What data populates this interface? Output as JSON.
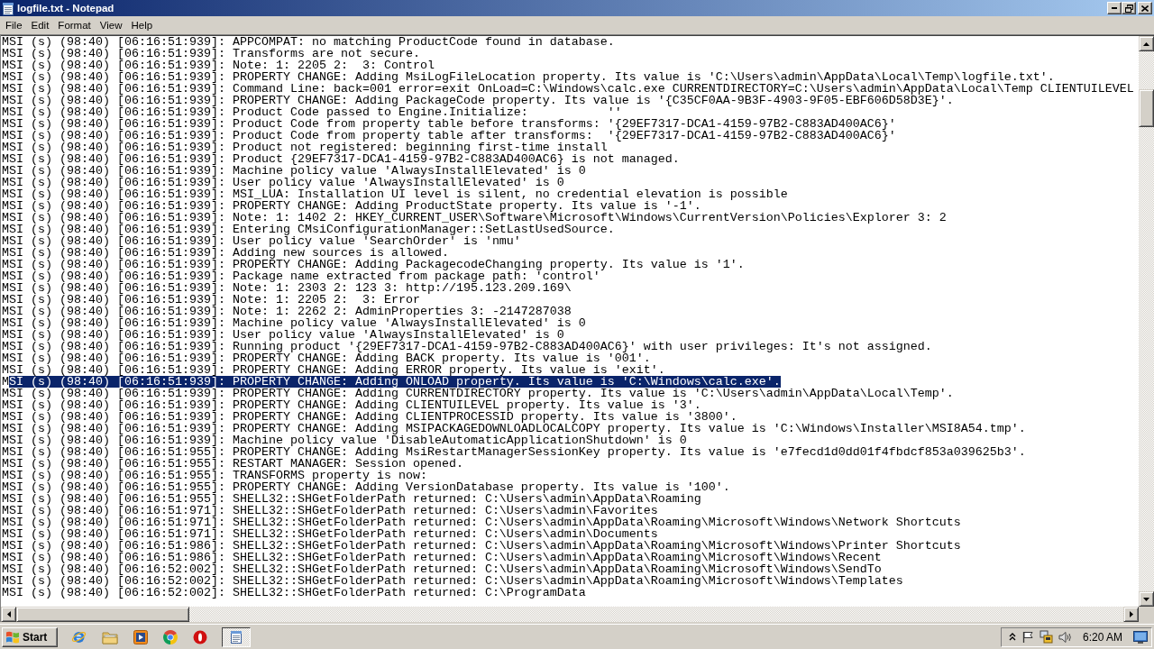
{
  "window": {
    "title": "logfile.txt - Notepad"
  },
  "menu": [
    "File",
    "Edit",
    "Format",
    "View",
    "Help"
  ],
  "lines": [
    {
      "text": "MSI (s) (98:40) [06:16:51:939]: APPCOMPAT: no matching ProductCode found in database."
    },
    {
      "text": "MSI (s) (98:40) [06:16:51:939]: Transforms are not secure."
    },
    {
      "text": "MSI (s) (98:40) [06:16:51:939]: Note: 1: 2205 2:  3: Control"
    },
    {
      "text": "MSI (s) (98:40) [06:16:51:939]: PROPERTY CHANGE: Adding MsiLogFileLocation property. Its value is 'C:\\Users\\admin\\AppData\\Local\\Temp\\logfile.txt'."
    },
    {
      "text": "MSI (s) (98:40) [06:16:51:939]: Command Line: back=001 error=exit OnLoad=C:\\Windows\\calc.exe CURRENTDIRECTORY=C:\\Users\\admin\\AppData\\Local\\Temp CLIENTUILEVEL"
    },
    {
      "text": "MSI (s) (98:40) [06:16:51:939]: PROPERTY CHANGE: Adding PackageCode property. Its value is '{C35CF0AA-9B3F-4903-9F05-EBF606D58D3E}'."
    },
    {
      "text": "MSI (s) (98:40) [06:16:51:939]: Product Code passed to Engine.Initialize:           ''"
    },
    {
      "text": "MSI (s) (98:40) [06:16:51:939]: Product Code from property table before transforms: '{29EF7317-DCA1-4159-97B2-C883AD400AC6}'"
    },
    {
      "text": "MSI (s) (98:40) [06:16:51:939]: Product Code from property table after transforms:  '{29EF7317-DCA1-4159-97B2-C883AD400AC6}'"
    },
    {
      "text": "MSI (s) (98:40) [06:16:51:939]: Product not registered: beginning first-time install"
    },
    {
      "text": "MSI (s) (98:40) [06:16:51:939]: Product {29EF7317-DCA1-4159-97B2-C883AD400AC6} is not managed."
    },
    {
      "text": "MSI (s) (98:40) [06:16:51:939]: Machine policy value 'AlwaysInstallElevated' is 0"
    },
    {
      "text": "MSI (s) (98:40) [06:16:51:939]: User policy value 'AlwaysInstallElevated' is 0"
    },
    {
      "text": "MSI (s) (98:40) [06:16:51:939]: MSI_LUA: Installation UI level is silent, no credential elevation is possible"
    },
    {
      "text": "MSI (s) (98:40) [06:16:51:939]: PROPERTY CHANGE: Adding ProductState property. Its value is '-1'."
    },
    {
      "text": "MSI (s) (98:40) [06:16:51:939]: Note: 1: 1402 2: HKEY_CURRENT_USER\\Software\\Microsoft\\Windows\\CurrentVersion\\Policies\\Explorer 3: 2"
    },
    {
      "text": "MSI (s) (98:40) [06:16:51:939]: Entering CMsiConfigurationManager::SetLastUsedSource."
    },
    {
      "text": "MSI (s) (98:40) [06:16:51:939]: User policy value 'SearchOrder' is 'nmu'"
    },
    {
      "text": "MSI (s) (98:40) [06:16:51:939]: Adding new sources is allowed."
    },
    {
      "text": "MSI (s) (98:40) [06:16:51:939]: PROPERTY CHANGE: Adding PackagecodeChanging property. Its value is '1'."
    },
    {
      "text": "MSI (s) (98:40) [06:16:51:939]: Package name extracted from package path: 'control'"
    },
    {
      "text": "MSI (s) (98:40) [06:16:51:939]: Note: 1: 2303 2: 123 3: http://195.123.209.169\\"
    },
    {
      "text": "MSI (s) (98:40) [06:16:51:939]: Note: 1: 2205 2:  3: Error"
    },
    {
      "text": "MSI (s) (98:40) [06:16:51:939]: Note: 1: 2262 2: AdminProperties 3: -2147287038"
    },
    {
      "text": "MSI (s) (98:40) [06:16:51:939]: Machine policy value 'AlwaysInstallElevated' is 0"
    },
    {
      "text": "MSI (s) (98:40) [06:16:51:939]: User policy value 'AlwaysInstallElevated' is 0"
    },
    {
      "text": "MSI (s) (98:40) [06:16:51:939]: Running product '{29EF7317-DCA1-4159-97B2-C883AD400AC6}' with user privileges: It's not assigned."
    },
    {
      "text": "MSI (s) (98:40) [06:16:51:939]: PROPERTY CHANGE: Adding BACK property. Its value is '001'."
    },
    {
      "text": "MSI (s) (98:40) [06:16:51:939]: PROPERTY CHANGE: Adding ERROR property. Its value is 'exit'."
    },
    {
      "text": "M",
      "selected_text": "SI (s) (98:40) [06:16:51:939]: PROPERTY CHANGE: Adding ONLOAD property. Its value is 'C:\\Windows\\calc.exe'."
    },
    {
      "text": "MSI (s) (98:40) [06:16:51:939]: PROPERTY CHANGE: Adding CURRENTDIRECTORY property. Its value is 'C:\\Users\\admin\\AppData\\Local\\Temp'."
    },
    {
      "text": "MSI (s) (98:40) [06:16:51:939]: PROPERTY CHANGE: Adding CLIENTUILEVEL property. Its value is '3'."
    },
    {
      "text": "MSI (s) (98:40) [06:16:51:939]: PROPERTY CHANGE: Adding CLIENTPROCESSID property. Its value is '3800'."
    },
    {
      "text": "MSI (s) (98:40) [06:16:51:939]: PROPERTY CHANGE: Adding MSIPACKAGEDOWNLOADLOCALCOPY property. Its value is 'C:\\Windows\\Installer\\MSI8A54.tmp'."
    },
    {
      "text": "MSI (s) (98:40) [06:16:51:939]: Machine policy value 'DisableAutomaticApplicationShutdown' is 0"
    },
    {
      "text": "MSI (s) (98:40) [06:16:51:955]: PROPERTY CHANGE: Adding MsiRestartManagerSessionKey property. Its value is 'e7fecd1d0dd01f4fbdcf853a039625b3'."
    },
    {
      "text": "MSI (s) (98:40) [06:16:51:955]: RESTART MANAGER: Session opened."
    },
    {
      "text": "MSI (s) (98:40) [06:16:51:955]: TRANSFORMS property is now:"
    },
    {
      "text": "MSI (s) (98:40) [06:16:51:955]: PROPERTY CHANGE: Adding VersionDatabase property. Its value is '100'."
    },
    {
      "text": "MSI (s) (98:40) [06:16:51:955]: SHELL32::SHGetFolderPath returned: C:\\Users\\admin\\AppData\\Roaming"
    },
    {
      "text": "MSI (s) (98:40) [06:16:51:971]: SHELL32::SHGetFolderPath returned: C:\\Users\\admin\\Favorites"
    },
    {
      "text": "MSI (s) (98:40) [06:16:51:971]: SHELL32::SHGetFolderPath returned: C:\\Users\\admin\\AppData\\Roaming\\Microsoft\\Windows\\Network Shortcuts"
    },
    {
      "text": "MSI (s) (98:40) [06:16:51:971]: SHELL32::SHGetFolderPath returned: C:\\Users\\admin\\Documents"
    },
    {
      "text": "MSI (s) (98:40) [06:16:51:986]: SHELL32::SHGetFolderPath returned: C:\\Users\\admin\\AppData\\Roaming\\Microsoft\\Windows\\Printer Shortcuts"
    },
    {
      "text": "MSI (s) (98:40) [06:16:51:986]: SHELL32::SHGetFolderPath returned: C:\\Users\\admin\\AppData\\Roaming\\Microsoft\\Windows\\Recent"
    },
    {
      "text": "MSI (s) (98:40) [06:16:52:002]: SHELL32::SHGetFolderPath returned: C:\\Users\\admin\\AppData\\Roaming\\Microsoft\\Windows\\SendTo"
    },
    {
      "text": "MSI (s) (98:40) [06:16:52:002]: SHELL32::SHGetFolderPath returned: C:\\Users\\admin\\AppData\\Roaming\\Microsoft\\Windows\\Templates"
    },
    {
      "text": "MSI (s) (98:40) [06:16:52:002]: SHELL32::SHGetFolderPath returned: C:\\ProgramData"
    }
  ],
  "taskbar": {
    "start": "Start",
    "windows": [
      {
        "selected": true
      }
    ],
    "clock": "6:20 AM"
  }
}
